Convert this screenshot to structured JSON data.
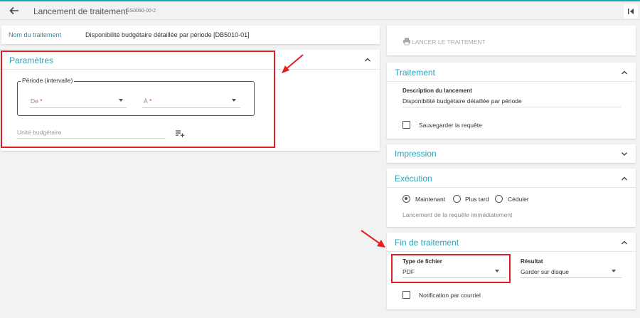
{
  "header": {
    "title": "Lancement de traitement",
    "code": "GS0090-00-2"
  },
  "traitement_name": {
    "label": "Nom du traitement",
    "value": "Disponibilité budgétaire détaillée par période [DB5010-01]"
  },
  "parametres": {
    "title": "Paramètres",
    "periode_label": "Période (intervalle)",
    "de_label": "De",
    "a_label": "À",
    "required_mark": "*",
    "unite_label": "Unité budgétaire"
  },
  "launch": {
    "label": "LANCER LE TRAITEMENT"
  },
  "traitement": {
    "title": "Traitement",
    "description_label": "Description du lancement",
    "description_value": "Disponibilité budgétaire détaillée par période",
    "save_query_label": "Sauvegarder la requête"
  },
  "impression": {
    "title": "Impression"
  },
  "execution": {
    "title": "Exécution",
    "options": [
      "Maintenant",
      "Plus tard",
      "Céduler"
    ],
    "selected": "Maintenant",
    "info": "Lancement de la requête immédiatement"
  },
  "fin": {
    "title": "Fin de traitement",
    "type_label": "Type de fichier",
    "type_value": "PDF",
    "resultat_label": "Résultat",
    "resultat_value": "Garder sur disque",
    "notification_label": "Notification par courriel"
  },
  "colors": {
    "accent": "#2aa3b9",
    "annotation": "#e02020"
  },
  "icons": {
    "back": "arrow-left-icon",
    "collapse_panel": "skip-left-icon",
    "printer": "printer-icon",
    "add_list": "playlist-add-icon",
    "chevron_up": "chevron-up-icon",
    "chevron_down": "chevron-down-icon",
    "dropdown": "caret-down-icon"
  }
}
